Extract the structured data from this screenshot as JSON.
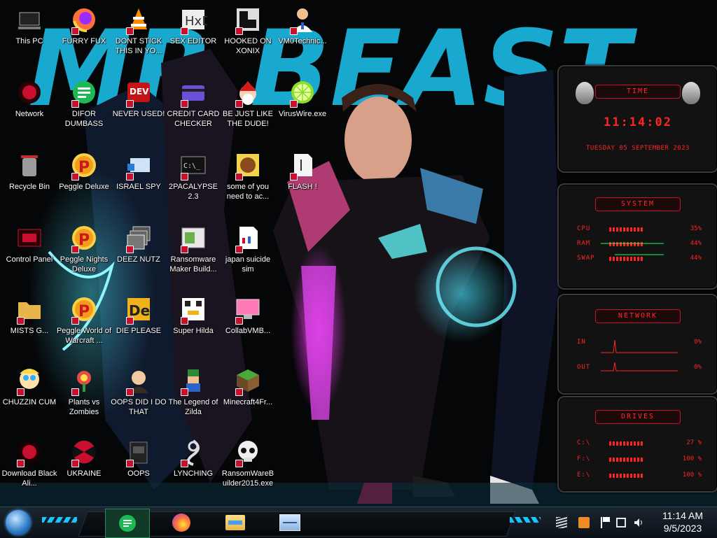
{
  "desktop": {
    "icons": [
      {
        "label": "This PC",
        "icon": "computer-icon"
      },
      {
        "label": "FURRY FUX",
        "icon": "firefox-icon"
      },
      {
        "label": "DONT STICK THIS IN YO...",
        "icon": "vlc-cone-icon"
      },
      {
        "label": "SEX EDITOR",
        "icon": "hxd-editor-icon"
      },
      {
        "label": "HOOKED ON XONIX",
        "icon": "xonix-game-icon"
      },
      {
        "label": "VM0Technic...",
        "icon": "doctor-icon"
      },
      {
        "label": "Network",
        "icon": "alien-network-icon"
      },
      {
        "label": "DIFOR DUMBASS",
        "icon": "notes-app-icon"
      },
      {
        "label": "NEVER USED!",
        "icon": "dev-cpp-icon"
      },
      {
        "label": "CREDIT CARD CHECKER",
        "icon": "credit-card-icon"
      },
      {
        "label": "BE JUST LIKE THE DUDE!",
        "icon": "santa-icon"
      },
      {
        "label": "VirusWire.exe",
        "icon": "lime-icon"
      },
      {
        "label": "Recycle Bin",
        "icon": "recycle-bin-icon"
      },
      {
        "label": "Peggle Deluxe",
        "icon": "peggle-icon"
      },
      {
        "label": "ISRAEL SPY",
        "icon": "spy-app-icon"
      },
      {
        "label": "2PACALYPSE 2.3",
        "icon": "terminal-icon"
      },
      {
        "label": "some of you need to ac...",
        "icon": "beaver-icon"
      },
      {
        "label": "FLASH !",
        "icon": "flash-document-icon"
      },
      {
        "label": "Control Panel",
        "icon": "control-panel-icon"
      },
      {
        "label": "Peggle Nights Deluxe",
        "icon": "peggle-icon"
      },
      {
        "label": "DEEZ NUTZ",
        "icon": "windows-stack-icon"
      },
      {
        "label": "Ransomware Maker Build...",
        "icon": "app-window-icon"
      },
      {
        "label": "japan suicide sim",
        "icon": "document-icon"
      },
      {
        "label": "MISTS G...",
        "icon": "folder-icon"
      },
      {
        "label": "Peggle World of Warcraft ...",
        "icon": "peggle-icon"
      },
      {
        "label": "DIE PLEASE",
        "icon": "de-letters-icon"
      },
      {
        "label": "Super Hilda",
        "icon": "pixel-cat-icon"
      },
      {
        "label": "CollabVMB...",
        "icon": "monitor-icon"
      },
      {
        "label": "CHUZZIN CUM",
        "icon": "cartoon-character-icon"
      },
      {
        "label": "Plants vs Zombies",
        "icon": "plant-icon"
      },
      {
        "label": "OOPS DID I DO THAT",
        "icon": "portrait-icon"
      },
      {
        "label": "The Legend of Zilda",
        "icon": "pixel-hero-icon"
      },
      {
        "label": "Minecraft4Fr...",
        "icon": "grass-block-icon"
      },
      {
        "label": "Download Black Ali...",
        "icon": "alien-orb-icon"
      },
      {
        "label": "UKRAINE",
        "icon": "radiation-icon"
      },
      {
        "label": "OOPS",
        "icon": "dark-book-icon"
      },
      {
        "label": "LYNCHING",
        "icon": "knot-icon"
      },
      {
        "label": "RansomWareBuilder2015.exe",
        "icon": "skull-icon"
      }
    ]
  },
  "wallpaper": {
    "banner_text": "MR BEAST"
  },
  "widget": {
    "time": {
      "title": "TIME",
      "time": "11:14:02",
      "date": "TUESDAY 05 SEPTEMBER 2023"
    },
    "system": {
      "title": "SYSTEM",
      "rows": [
        {
          "label": "CPU",
          "value": "35%"
        },
        {
          "label": "RAM",
          "value": "44%"
        },
        {
          "label": "SWAP",
          "value": "44%"
        }
      ]
    },
    "network": {
      "title": "NETWORK",
      "rows": [
        {
          "label": "IN",
          "value": "0%"
        },
        {
          "label": "OUT",
          "value": "0%"
        }
      ]
    },
    "drives": {
      "title": "DRIVES",
      "rows": [
        {
          "label": "C:\\",
          "value": "27 %"
        },
        {
          "label": "F:\\",
          "value": "100 %"
        },
        {
          "label": "E:\\",
          "value": "100 %"
        }
      ]
    }
  },
  "taskbar": {
    "start_icon": "start-orb-icon",
    "pinned": [
      {
        "name": "notes-app",
        "icon": "notes-app-icon"
      },
      {
        "name": "firefox",
        "icon": "firefox-icon"
      },
      {
        "name": "file-explorer",
        "icon": "folder-icon"
      },
      {
        "name": "task-manager",
        "icon": "monitor-icon"
      }
    ],
    "tray_icons": [
      "keyboard-icon",
      "app-tray-icon",
      "flag-icon",
      "network-icon",
      "volume-icon"
    ],
    "clock": {
      "time": "11:14 AM",
      "date": "9/5/2023"
    }
  },
  "colors": {
    "accent_red": "#ff2424",
    "cyan": "#16b6d9",
    "taskbar": "#101820"
  }
}
